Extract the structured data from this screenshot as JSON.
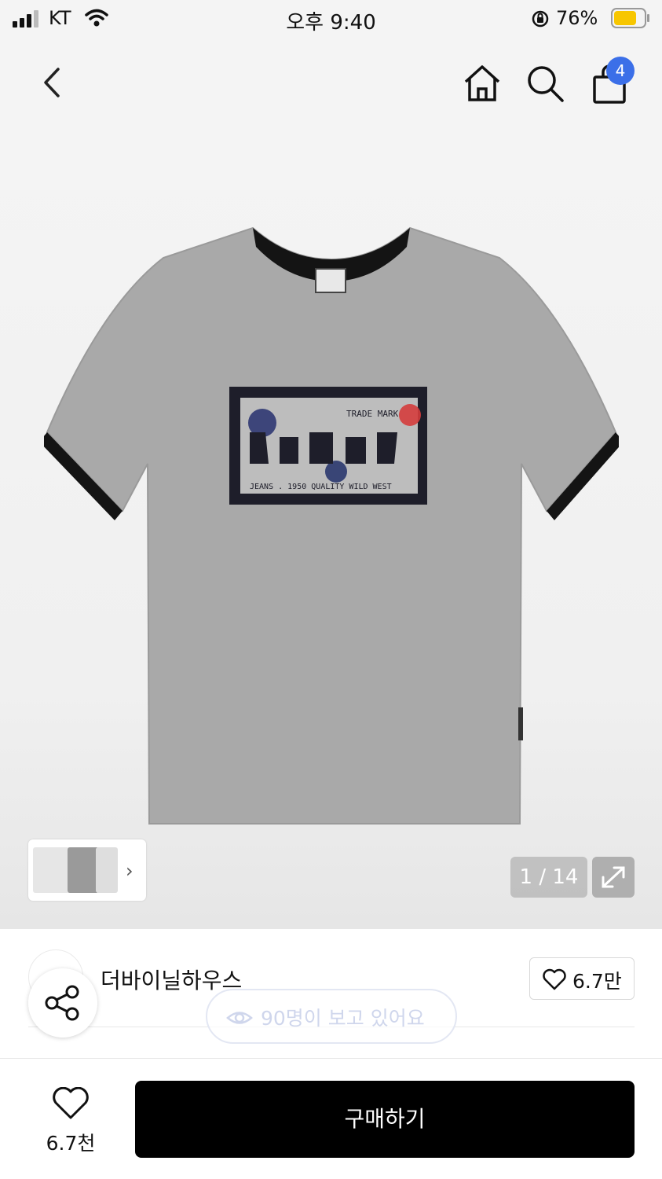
{
  "status_bar": {
    "carrier": "KT",
    "time": "오후 9:40",
    "battery_percent": "76%",
    "battery_level": 0.76,
    "battery_color": "#f7c600"
  },
  "nav": {
    "back_icon": "chevron-left-icon",
    "home_icon": "home-icon",
    "search_icon": "search-icon",
    "cart_icon": "shopping-bag-icon",
    "cart_count": "4",
    "badge_color": "#3b6fe8"
  },
  "gallery": {
    "page_counter": "1 / 14",
    "expand_icon": "expand-arrows-icon",
    "thumbnail_arrow": "›",
    "tshirt_print_text": {
      "trade_mark": "TRADE MARK",
      "bottom_line": "JEANS . 1950  QUALITY WILD WEST"
    }
  },
  "product": {
    "brand": "더바이닐하우스",
    "like_count": "6.7만",
    "viewers_text": "90명이 보고 있어요",
    "share_icon": "share-icon"
  },
  "bottom_bar": {
    "wish_count": "6.7천",
    "buy_label": "구매하기"
  }
}
